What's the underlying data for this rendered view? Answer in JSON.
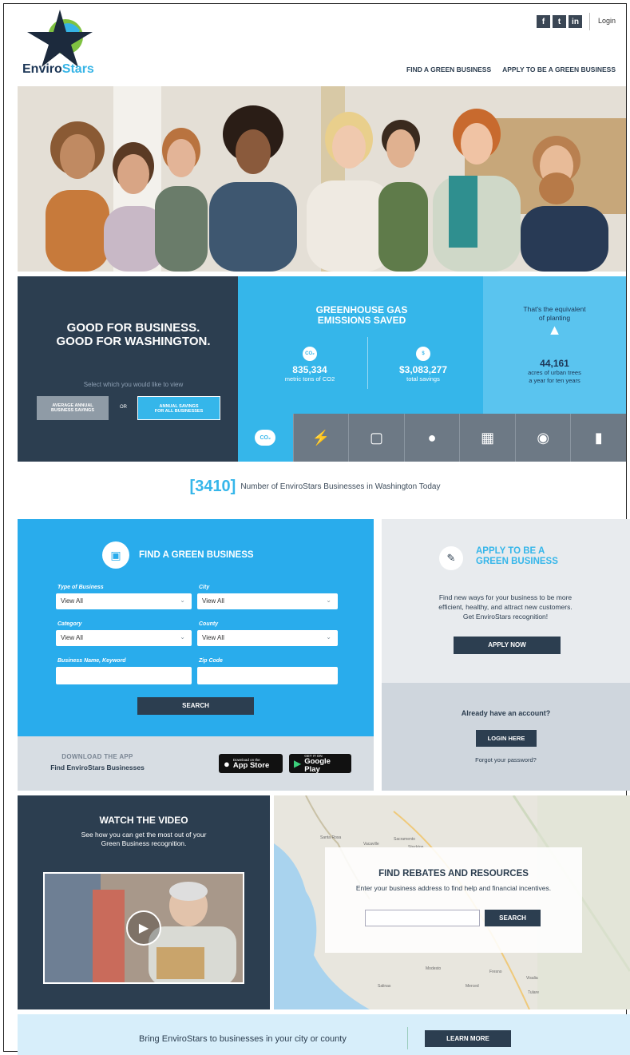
{
  "header": {
    "logo_text_a": "Enviro",
    "logo_text_b": "Stars",
    "social": [
      "f",
      "t",
      "in"
    ],
    "login": "Login",
    "nav": [
      "FIND A GREEN BUSINESS",
      "APPLY TO BE A GREEN BUSINESS"
    ]
  },
  "stats": {
    "headline_1": "GOOD FOR BUSINESS.",
    "headline_2": "GOOD FOR WASHINGTON.",
    "select_label": "Select which you would like to view",
    "btn_avg_1": "AVERAGE ANNUAL",
    "btn_avg_2": "BUSINESS SAVINGS",
    "or": "OR",
    "btn_all_1": "ANNUAL SAVINGS",
    "btn_all_2": "FOR ALL BUSINESSES",
    "ghg_1": "GREENHOUSE GAS",
    "ghg_2": "EMISSIONS SAVED",
    "co2_icon": "CO₂",
    "co2_value": "835,334",
    "co2_sub": "metric tons of CO2",
    "savings_value": "$3,083,277",
    "savings_sub": "total savings",
    "equiv_1": "That's the equivalent",
    "equiv_2": "of planting",
    "trees_value": "44,161",
    "trees_sub_1": "acres of urban trees",
    "trees_sub_2": "a year for ten years",
    "tabs": [
      "co2-icon",
      "plug-icon",
      "trash-icon",
      "water-drop-icon",
      "barrel-icon",
      "piggy-bank-icon",
      "fuel-pump-icon"
    ]
  },
  "count": {
    "value": "[3410]",
    "label": "Number of EnviroStars Businesses in Washington Today"
  },
  "find": {
    "title": "FIND A GREEN BUSINESS",
    "type_label": "Type of Business",
    "type_value": "View All",
    "city_label": "City",
    "city_value": "View All",
    "category_label": "Category",
    "category_value": "View All",
    "county_label": "County",
    "county_value": "View All",
    "keyword_label": "Business Name, Keyword",
    "zip_label": "Zip Code",
    "search": "SEARCH"
  },
  "app": {
    "title": "DOWNLOAD THE APP",
    "sub": "Find EnviroStars Businesses",
    "appstore_small": "Download on the",
    "appstore_big": "App Store",
    "gplay_small": "GET IT ON",
    "gplay_big": "Google Play"
  },
  "apply": {
    "title_1": "APPLY TO BE A",
    "title_2": "GREEN BUSINESS",
    "text_1": "Find new ways for your business to be more",
    "text_2": "efficient, healthy, and attract new customers.",
    "text_3": "Get EnviroStars recognition!",
    "button": "APPLY NOW"
  },
  "account": {
    "question": "Already have an account?",
    "button": "LOGIN HERE",
    "forgot": "Forgot your password?"
  },
  "video": {
    "title": "WATCH THE VIDEO",
    "sub_1": "See how you can get the most out of your",
    "sub_2": "Green Business recognition."
  },
  "rebates": {
    "title": "FIND REBATES AND RESOURCES",
    "sub": "Enter your business address to find help and financial incentives.",
    "button": "SEARCH",
    "map_labels": [
      "Sacramento",
      "Santa Rosa",
      "Vacaville",
      "Stockton",
      "Modesto",
      "Merced",
      "Fresno",
      "Salinas",
      "Visalia",
      "Tulare"
    ]
  },
  "bottom": {
    "text": "Bring EnviroStars to businesses in your city or county",
    "button": "LEARN MORE"
  },
  "colors": {
    "navy": "#2c3e50",
    "blue": "#35b6ea",
    "grey_tab": "#6d7985"
  }
}
